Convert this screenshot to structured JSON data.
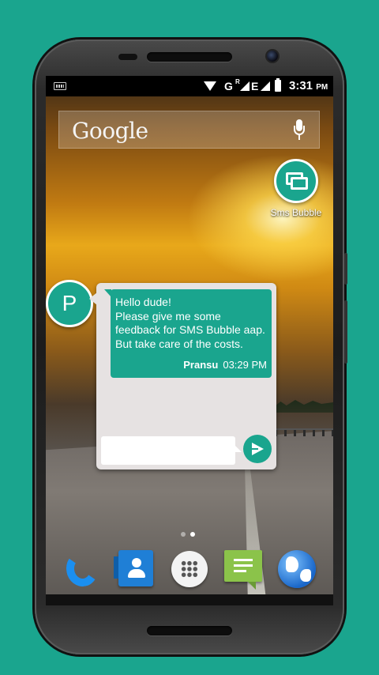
{
  "status_bar": {
    "network_g": "G",
    "network_r": "R",
    "network_e": "E",
    "time": "3:31",
    "ampm": "PM"
  },
  "search": {
    "logo_text": "Google"
  },
  "home_apps": {
    "sms_bubble_label": "Sms Bubble"
  },
  "chat_head": {
    "initial": "P"
  },
  "chat": {
    "message_text": "Hello dude!\nPlease give me some\nfeedback for SMS Bubble aap.\nBut take care of the costs.",
    "sender": "Pransu",
    "timestamp": "03:29 PM",
    "reply_value": ""
  },
  "page_indicator": {
    "pages": 2,
    "active_page": 2
  },
  "dock": {
    "icons": [
      "phone-icon",
      "contacts-icon",
      "app-drawer-icon",
      "messaging-icon",
      "browser-icon"
    ]
  },
  "colors": {
    "accent": "#1aa58e",
    "background": "#1aa58e"
  }
}
